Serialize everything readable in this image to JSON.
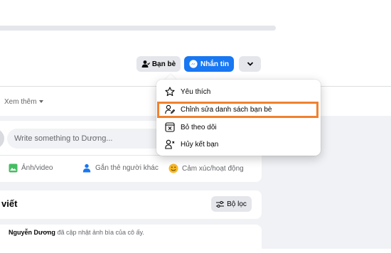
{
  "header": {
    "friends_button": "Bạn bè",
    "message_button": "Nhắn tin",
    "more_icon": "chevron-down-icon"
  },
  "tabs": {
    "see_more": "Xem thêm"
  },
  "dropdown_menu": {
    "items": [
      {
        "label": "Yêu thích",
        "icon": "star-icon"
      },
      {
        "label": "Chỉnh sửa danh sách bạn bè",
        "icon": "edit-friends-icon",
        "highlighted": true
      },
      {
        "label": "Bỏ theo dõi",
        "icon": "unfollow-icon"
      },
      {
        "label": "Hủy kết bạn",
        "icon": "unfriend-icon"
      }
    ]
  },
  "composer": {
    "placeholder": "Write something to Dương...",
    "actions": [
      {
        "label": "Ảnh/video",
        "icon": "photo-icon"
      },
      {
        "label": "Gắn thẻ người khác",
        "icon": "tag-people-icon"
      },
      {
        "label": "Cảm xúc/hoạt động",
        "icon": "feeling-icon"
      }
    ]
  },
  "posts": {
    "title": "viết",
    "filter_button": "Bộ lọc"
  },
  "activity": {
    "name": "Nguyễn Dương",
    "text": "đã cập nhật ảnh bìa của cô ấy."
  },
  "colors": {
    "accent": "#1877f2",
    "highlight": "#f0812e",
    "background": "#f0f2f5"
  }
}
